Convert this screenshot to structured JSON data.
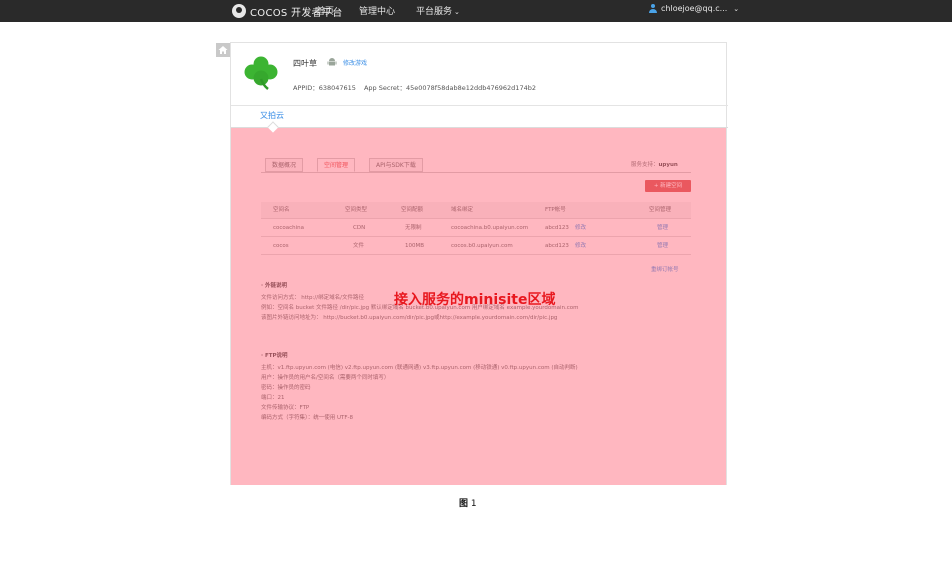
{
  "topbar": {
    "logo_text": "COCOS 开发者平台",
    "nav": [
      {
        "label": "首页"
      },
      {
        "label": "管理中心"
      },
      {
        "label": "平台服务"
      }
    ],
    "user": "chloejoe@qq.c..."
  },
  "game": {
    "name": "四叶草",
    "edit_link": "修改游戏",
    "appid_label": "APPID：638047615",
    "secret_label": "App Secret：45e0078f58dab8e12ddb476962d174b2"
  },
  "tab": "又拍云",
  "minisite": {
    "tabs": [
      "数据概况",
      "空间管理",
      "API与SDK下载"
    ],
    "provider_label": "服务支持：",
    "provider_name": "upyun",
    "new_button": "+ 新建空间",
    "table": {
      "headers": [
        "空间名",
        "空间类型",
        "空间配额",
        "域名绑定",
        "FTP帐号",
        "空间管理"
      ],
      "rows": [
        {
          "name": "cocoachina",
          "type": "CDN",
          "quota": "无限制",
          "domain": "cocoachina.b0.upaiyun.com",
          "ftp": "abcd123",
          "ftp_action": "修改",
          "manage": "管理"
        },
        {
          "name": "cocos",
          "type": "文件",
          "quota": "100MB",
          "domain": "cocos.b0.upaiyun.com",
          "ftp": "abcd123",
          "ftp_action": "修改",
          "manage": "管理"
        }
      ]
    },
    "switch_account": "重绑订帐号",
    "external": {
      "title": "· 外链说明",
      "lines": [
        "文件访问方式： http://绑定域名/文件路径",
        "例如：空间名 bucket   文件路径 /dir/pic.jpg      默认绑定域名 bucket.b0.upaiyun.com     用户绑定域名 example.yourdomain.com",
        "该图片外链访问地址为： http://bucket.b0.upaiyun.com/dir/pic.jpg或http://example.yourdomain.com/dir/pic.jpg"
      ]
    },
    "ftp": {
      "title": "· FTP说明",
      "lines": [
        "主机：v1.ftp.upyun.com (电信)   v2.ftp.upyun.com (联通网通)   v3.ftp.upyun.com (移动铁通)   v0.ftp.upyun.com (自动判断)",
        "用户：操作员的用户名/空间名（需要两个同时填写）",
        "密码：操作员的密码",
        "端口：21",
        "文件传输协议：FTP",
        "编码方式（字符集）：统一使用 UTF-8"
      ]
    },
    "overlay_label": "接入服务的minisite区域"
  },
  "caption": {
    "prefix": "图",
    "number": "1"
  },
  "colors": {
    "topbar": "#2a2a2a",
    "accent": "#3a8ee6",
    "overlay": "#ff5f73",
    "overlay_label": "#e8181f"
  }
}
